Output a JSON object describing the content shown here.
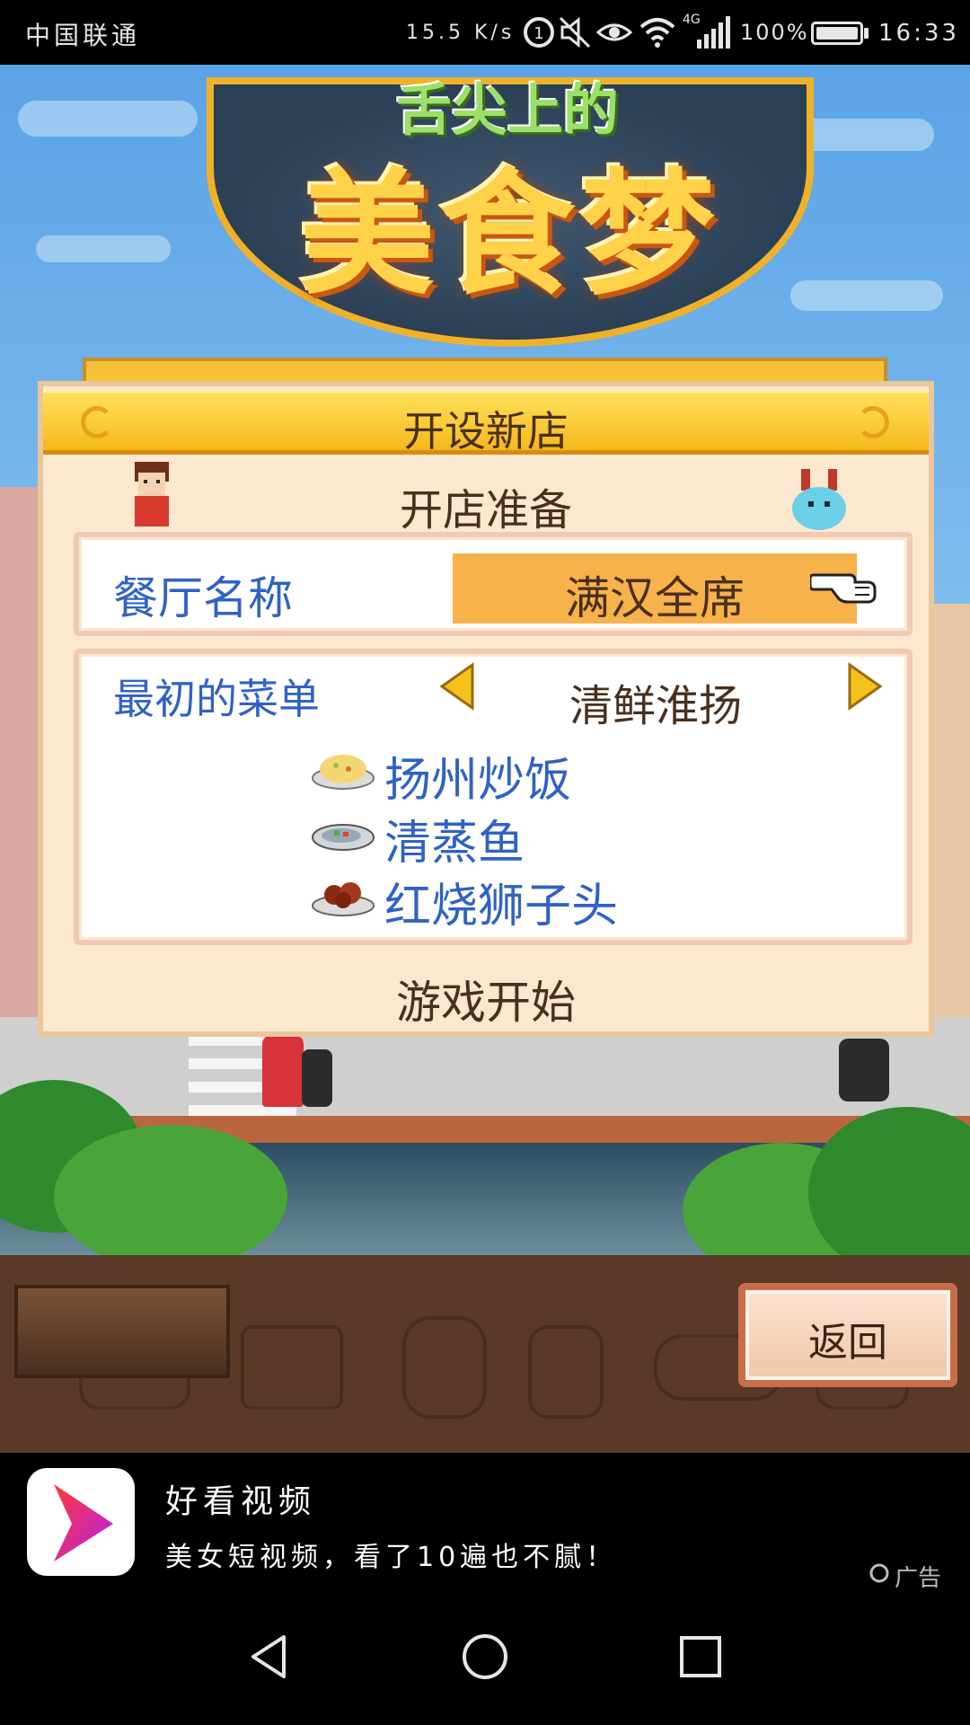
{
  "status_bar": {
    "carrier": "中国联通",
    "net_speed": "15.5 K/s",
    "battery_percent": "100%",
    "battery_level": 1.0,
    "time": "16:33",
    "signal_type": "4G",
    "icons": [
      "data-saver-icon",
      "mute-icon",
      "eye-comfort-icon",
      "wifi-icon",
      "signal-icon",
      "battery-icon"
    ]
  },
  "game": {
    "logo_title": "美食梦",
    "logo_subtitle": "舌尖上的",
    "dialog": {
      "title": "开设新店",
      "section_title": "开店准备",
      "restaurant_name_label": "餐厅名称",
      "restaurant_name_value": "满汉全席",
      "menu_label": "最初的菜单",
      "menu_value": "清鲜淮扬",
      "dishes": [
        {
          "name": "扬州炒饭",
          "icon": "fried-rice-icon"
        },
        {
          "name": "清蒸鱼",
          "icon": "steamed-fish-icon"
        },
        {
          "name": "红烧狮子头",
          "icon": "braised-meatball-icon"
        }
      ],
      "start_label": "游戏开始"
    },
    "back_button_label": "返回"
  },
  "ad": {
    "app_name": "好看视频",
    "description": "美女短视频，看了10遍也不腻！",
    "tag": "广告",
    "colors": {
      "icon_gradient_start": "#ff3b30",
      "icon_gradient_end": "#b61cf0"
    }
  },
  "colors": {
    "label_blue": "#2f62c4",
    "text_brown": "#4a2f1c",
    "field_orange": "#f7b24b",
    "header_yellow": "#f5b81c",
    "dialog_bg": "#fbe8cf"
  }
}
